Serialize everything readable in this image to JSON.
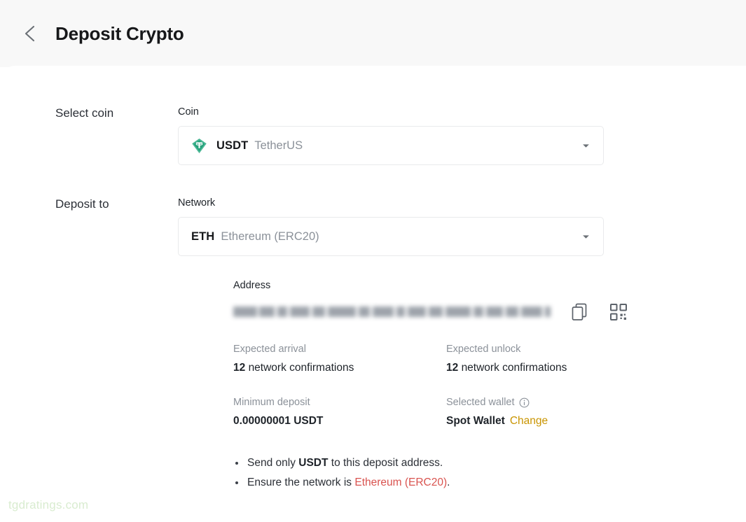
{
  "header": {
    "back_icon": "chevron-left-icon",
    "title": "Deposit Crypto"
  },
  "sections": {
    "select_coin_label": "Select coin",
    "deposit_to_label": "Deposit to"
  },
  "coin_field": {
    "label": "Coin",
    "icon": "tether-usdt-icon",
    "symbol": "USDT",
    "name": "TetherUS",
    "caret_icon": "caret-down-icon"
  },
  "network_field": {
    "label": "Network",
    "symbol": "ETH",
    "name": "Ethereum (ERC20)",
    "caret_icon": "caret-down-icon"
  },
  "address_field": {
    "label": "Address",
    "value": "",
    "redacted": true,
    "copy_icon": "copy-icon",
    "qr_icon": "qr-code-icon"
  },
  "info": {
    "expected_arrival": {
      "key": "Expected arrival",
      "value_number": "12",
      "value_text": "network confirmations"
    },
    "expected_unlock": {
      "key": "Expected unlock",
      "value_number": "12",
      "value_text": "network confirmations"
    },
    "minimum_deposit": {
      "key": "Minimum deposit",
      "value": "0.00000001 USDT"
    },
    "selected_wallet": {
      "key": "Selected wallet",
      "info_icon": "info-circle-icon",
      "value": "Spot Wallet",
      "change_link": "Change"
    }
  },
  "notes": {
    "item1_pre": "Send only ",
    "item1_token": "USDT",
    "item1_post": " to this deposit address.",
    "item2_pre": "Ensure the network is ",
    "item2_token": "Ethereum (ERC20)",
    "item2_post": "."
  },
  "watermark": "tgdratings.com",
  "colors": {
    "header_bg": "#f8f8f8",
    "title": "#17181a",
    "muted": "#8b9199",
    "accent_gold": "#c99400",
    "accent_red": "#d9534f",
    "tether_green": "#26a17b",
    "watermark": "#d9ecd0"
  }
}
